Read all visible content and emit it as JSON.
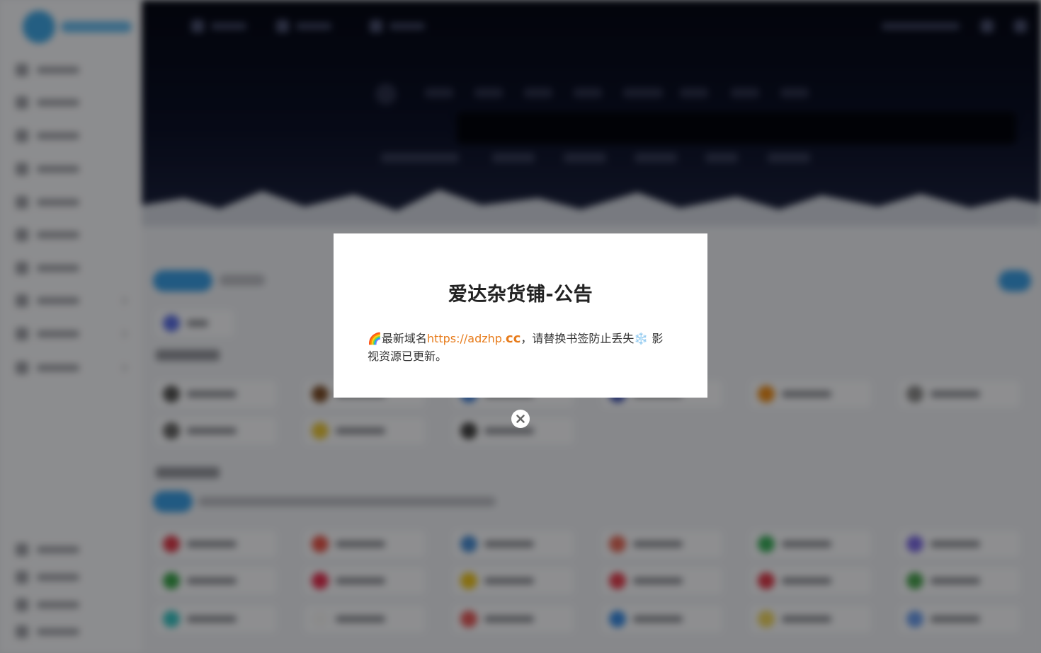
{
  "modal": {
    "title": "爱达杂货铺-公告",
    "body_prefix": "最新域名",
    "link_main": "https://adzhp.",
    "link_tld": "cc",
    "body_suffix": "，请替换书签防止丢失",
    "body_tail": " 影视资源已更新。"
  },
  "icons": {
    "rainbow": "rainbow-icon",
    "snowflake": "snowflake-icon",
    "close": "close-icon"
  },
  "colors": {
    "link": "#e77b1a",
    "accent": "#3a9be0"
  }
}
